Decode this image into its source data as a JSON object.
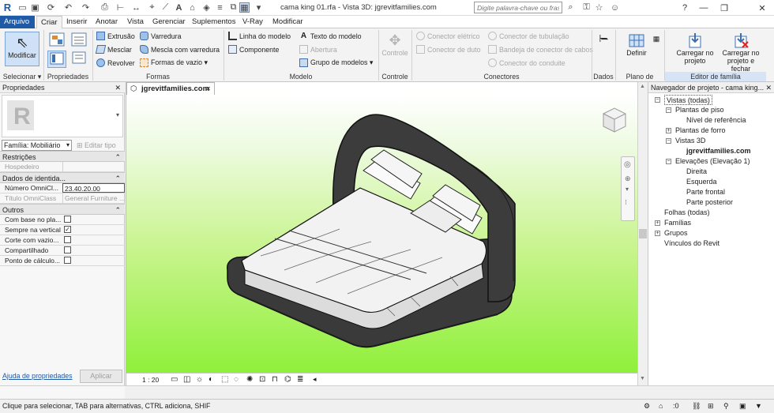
{
  "window": {
    "title": "cama king 01.rfa - Vista 3D: jgrevitfamilies.com",
    "search_placeholder": "Digite palavra-chave ou frase",
    "minimize": "—",
    "restore": "❐",
    "close": "✕"
  },
  "menu": {
    "tabs": [
      "Arquivo",
      "Criar",
      "Inserir",
      "Anotar",
      "Vista",
      "Gerenciar",
      "Suplementos",
      "V-Ray",
      "Modificar"
    ],
    "active_tab": "Criar"
  },
  "ribbon": {
    "modificar": "Modificar",
    "selecionar": "Selecionar ▾",
    "propriedades": "Propriedades",
    "formas": {
      "label": "Formas",
      "items": [
        "Extrusão",
        "Mesclar",
        "Revolver",
        "Varredura",
        "Mescla com varredura",
        "Formas de vazio ▾"
      ]
    },
    "modelo": {
      "label": "Modelo",
      "items": [
        "Linha do modelo",
        "Componente",
        "Texto do modelo",
        "Abertura",
        "Grupo de modelos ▾"
      ]
    },
    "controle": {
      "label": "Controle",
      "item": "Controle"
    },
    "conectores": {
      "label": "Conectores",
      "items": [
        "Conector elétrico",
        "Conector de duto",
        "Conector de tubulação",
        "Bandeja de conector de cabos",
        "Conector do conduite"
      ]
    },
    "dados": {
      "label": "Dados"
    },
    "plano": {
      "label": "Plano de trabalho",
      "definir": "Definir"
    },
    "editor": {
      "label": "Editor de família",
      "carregar_projeto": "Carregar no projeto",
      "carregar_fechar": "Carregar no projeto e fechar"
    }
  },
  "properties": {
    "title": "Propriedades",
    "family_selector": "Família: Mobiliário",
    "edit_type": "Editar tipo",
    "sections": [
      {
        "name": "Restrições",
        "rows": [
          {
            "k": "Hospedeiro",
            "v": ""
          }
        ]
      },
      {
        "name": "Dados de identida...",
        "rows": [
          {
            "k": "Número OmniCl...",
            "v": "23.40.20.00"
          },
          {
            "k": "Título OmniClass",
            "v": "General Furniture ..."
          }
        ]
      },
      {
        "name": "Outros",
        "rows": [
          {
            "k": "Com base no pla...",
            "checked": false
          },
          {
            "k": "Sempre na vertical",
            "checked": true
          },
          {
            "k": "Corte com vazio...",
            "checked": false
          },
          {
            "k": "Compartilhado",
            "checked": false
          },
          {
            "k": "Ponto de cálculo...",
            "checked": false
          }
        ]
      }
    ],
    "help_link": "Ajuda de propriedades",
    "apply": "Aplicar"
  },
  "view": {
    "tab_title": "jgrevitfamilies.com",
    "scale": "1 : 20"
  },
  "project_browser": {
    "title": "Navegador de projeto - cama king...",
    "tree": [
      {
        "label": "Vistas (todas)",
        "level": 0,
        "toggle": "−"
      },
      {
        "label": "Plantas de piso",
        "level": 1,
        "toggle": "−"
      },
      {
        "label": "Nível de referência",
        "level": 2,
        "toggle": ""
      },
      {
        "label": "Plantas de forro",
        "level": 1,
        "toggle": "+"
      },
      {
        "label": "Vistas 3D",
        "level": 1,
        "toggle": "−"
      },
      {
        "label": "jgrevitfamilies.com",
        "level": 2,
        "toggle": "",
        "bold": true
      },
      {
        "label": "Elevações (Elevação 1)",
        "level": 1,
        "toggle": "−"
      },
      {
        "label": "Direita",
        "level": 2,
        "toggle": ""
      },
      {
        "label": "Esquerda",
        "level": 2,
        "toggle": ""
      },
      {
        "label": "Parte frontal",
        "level": 2,
        "toggle": ""
      },
      {
        "label": "Parte posterior",
        "level": 2,
        "toggle": ""
      },
      {
        "label": "Folhas (todas)",
        "level": 0,
        "toggle": ""
      },
      {
        "label": "Famílias",
        "level": 0,
        "toggle": "+"
      },
      {
        "label": "Grupos",
        "level": 0,
        "toggle": "+"
      },
      {
        "label": "Vínculos do Revit",
        "level": 0,
        "toggle": ""
      }
    ]
  },
  "status": {
    "text": "Clique para selecionar, TAB para alternativas, CTRL adiciona, SHIF",
    "filter": ":0"
  }
}
